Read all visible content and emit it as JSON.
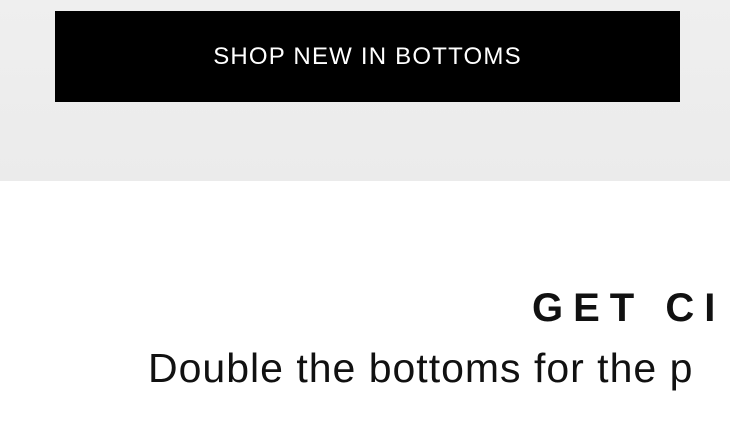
{
  "hero": {
    "cta_label": "SHOP NEW IN BOTTOMS"
  },
  "promo": {
    "headline": "GET CI",
    "subline": "Double the bottoms for the p"
  },
  "colors": {
    "cta_background": "#000000",
    "cta_text": "#ffffff",
    "hero_background": "#eeeeee",
    "text": "#111111"
  }
}
